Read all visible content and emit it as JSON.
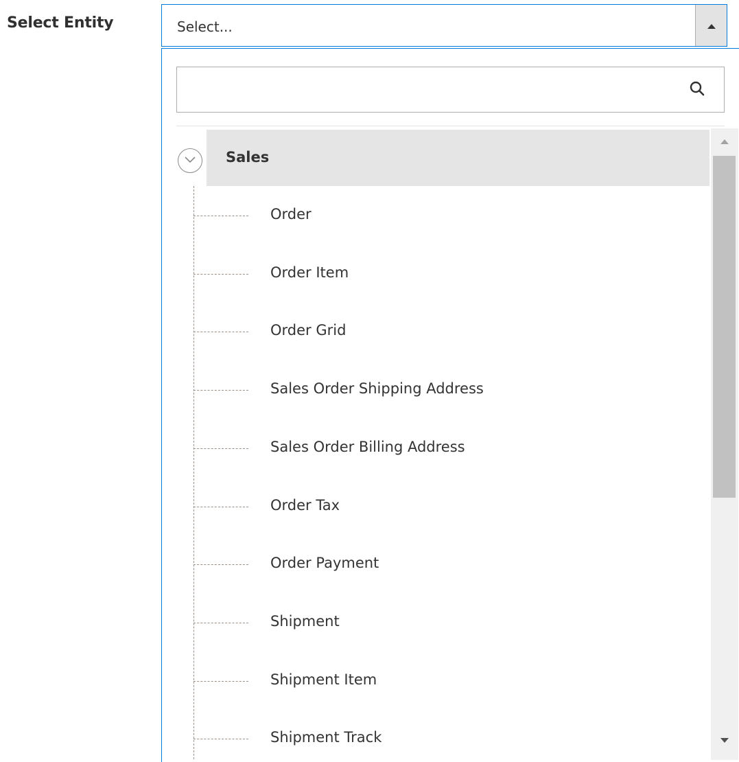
{
  "field": {
    "label": "Select Entity"
  },
  "select": {
    "value": "Select..."
  },
  "dropdown": {
    "search": {
      "value": "",
      "placeholder": ""
    },
    "group": {
      "label": "Sales",
      "expanded": true
    },
    "items": [
      {
        "label": "Order"
      },
      {
        "label": "Order Item"
      },
      {
        "label": "Order Grid"
      },
      {
        "label": "Sales Order Shipping Address"
      },
      {
        "label": "Sales Order Billing Address"
      },
      {
        "label": "Order Tax"
      },
      {
        "label": "Order Payment"
      },
      {
        "label": "Shipment"
      },
      {
        "label": "Shipment Item"
      },
      {
        "label": "Shipment Track"
      }
    ],
    "scroll_position": 0
  },
  "colors": {
    "accent": "#007bdb",
    "group_bg": "#e5e5e5",
    "text": "#333333"
  }
}
